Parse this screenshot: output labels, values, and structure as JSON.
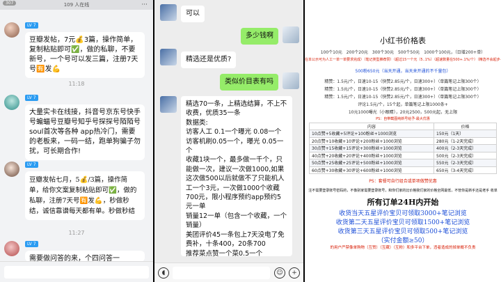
{
  "chat1": {
    "online_count": "109 人在线",
    "level": "LV 7",
    "msg1": "豆瓣发帖，7元💰3篇，操作简单，复制粘贴即可✅，做的私聊，不要新号，一个号可以发三篇，注册7天号🈶发💪",
    "time1": "11:18",
    "msg2": "大量实卡在线接，抖音号京东号快手号蝙蝠号豆瓣号知乎号探探号陌陌号 soul首次等各种 app热冷门，需要的老板来，一码一结，跑单狗骗子勿扰，可长期合作!",
    "time2": "11:26",
    "msg3": "豆瓣发帖七月，5💰/3篇，操作简单，给你文案复制粘贴即可✅，做的私聊，注册7天号🈶发💪，秒做秒结，诚信靠谱每天都有单。秒做秒结",
    "time3": "11:27",
    "msg4": "需要做问答的来，个四问答一"
  },
  "chat2": {
    "m1": "可以",
    "m2": "多少钱啊",
    "m3": "精选还是优质?",
    "m4": "类似价目表有吗",
    "m5": "精选70一条，上精选结算，不上不收费，优质35一条\n数据类:\n访客人工 0.1一个曝光 0.08一个\n访客机刷0.05一个，曝光 0.05一个\n收藏1块一个，最多做一千个，只能做一次，建议一次做1000,如果这次做500以后就做不了只能机人工一个3元，一次做1000个收藏700元，限小程序预约app预约5元一单\n销量12一单（包含一个收藏，一个销量）\n美团评价45一条包上7天没电了免费补，十条400，20条700\n推荐菜点赞一个菜0.5一个\n笔记评论浏览30一千，200一万\n评价点赞1块一个"
  },
  "price": {
    "title": "小红书价格表",
    "line1": "100个10元　200个20元　300个30元　500个50元　1000个100元，（日增200+单）",
    "line2": "在本公示可为人工一单一单要求完成）（笔记类型推荐赞）（超过15一个元（5..1%）（超速数量在500+.1%/个）（精选不会起步·增单请询问）",
    "line3": "500粉650元（当天开通，当天来开通的不千量包）",
    "line4": "精赞：1.5元/个，日速10-15（快赞2.85元/个，日速300+）（单篇笔记上限300个）",
    "line5": "精赞：1.5元/个，日速10-15（快赞2.85元/个，日速300+）（单篇笔记上限300个）",
    "line6": "精赞：1.5元/个，日速10-15（快赞2.85元/个，日速300+）（单篇笔记上限300个）",
    "line7": "评论1.5元/个，15个起，单篇笔记上限1000条+",
    "line8": "10元1000曝光（小眼睛），20元2500，500元起，无上限",
    "line9": "PS：自带截图纯新号给予·最大优惠",
    "table_header_left": "内容",
    "table_header_right": "价格",
    "table_rows": [
      {
        "content": "10点赞+5收藏+5评论+100粉丝+1000浏览",
        "price": "150元（1天）"
      },
      {
        "content": "20点赞+10收藏+10评论+200粉丝+1000浏览",
        "price": "280元（1-2天完成）"
      },
      {
        "content": "30点赞+15收藏+15评论+300粉丝+1000浏览",
        "price": "400元（2-3天完成）"
      },
      {
        "content": "40点赞+20收藏+20评论+400粉丝+1000浏览",
        "price": "500元（2-3天完成）"
      },
      {
        "content": "50点赞+25收藏+25评论+500粉丝+1000浏览",
        "price": "550元（2-3天完成）"
      },
      {
        "content": "60点赞+30收藏+30评论+600粉丝+1000浏览",
        "price": "650元（3-4天完成）"
      }
    ],
    "note1": "PS：套餐可自行组合或单项做赞优惠",
    "note2": "注不需要登录账号密码的，不像别家需要登录账号，和你们家的比价格我们家的价格全网最低，不管你是新手还是老手 收单",
    "big1": "所有订单24H内开始",
    "promo1": "收货当天五星评价宝贝可领取3000+笔记浏览",
    "promo2": "收货第二天五星评价宝贝可领取1500+笔记浏览",
    "promo3": "收货第三天五星评价宝贝可领取500+笔记浏览",
    "promo4": "（实付金额≥50）",
    "footer": "的用户严禁像单购物（互赞）（互藏）（互粉）和多平台下单，违者造成的掉单概不负责"
  }
}
